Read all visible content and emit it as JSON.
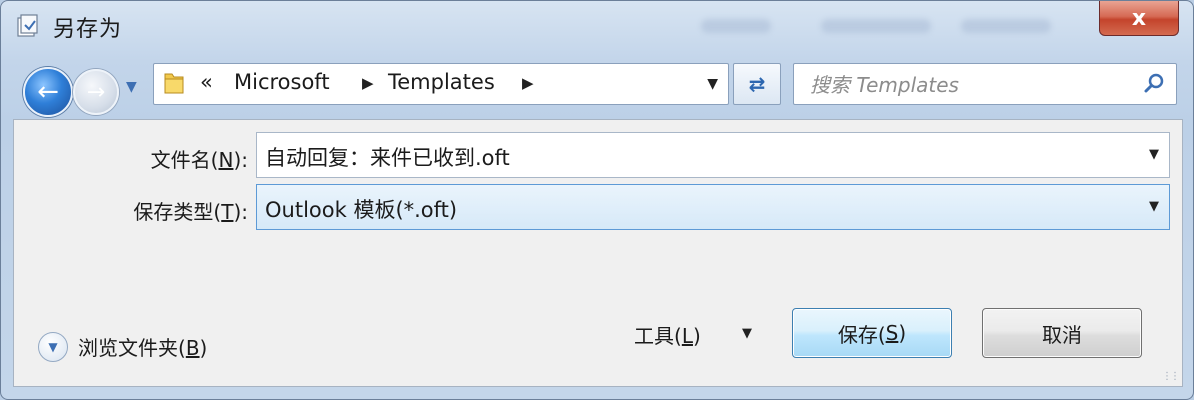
{
  "window": {
    "title": "另存为",
    "close_label": "x"
  },
  "nav": {
    "crumbs": [
      "«",
      "Microsoft",
      "Templates"
    ],
    "search_placeholder": "搜索 Templates"
  },
  "fields": {
    "filename_label_pre": "文件名(",
    "filename_label_key": "N",
    "filename_label_post": "):",
    "filename_value": "自动回复：来件已收到.oft",
    "type_label_pre": "保存类型(",
    "type_label_key": "T",
    "type_label_post": "):",
    "type_value": "Outlook 模板(*.oft)"
  },
  "footer": {
    "browse_pre": "浏览文件夹(",
    "browse_key": "B",
    "browse_post": ")",
    "tools_pre": "工具(",
    "tools_key": "L",
    "tools_post": ")",
    "save_pre": "保存(",
    "save_key": "S",
    "save_post": ")",
    "cancel_label": "取消"
  },
  "colors": {
    "accent": "#3c7fb1",
    "close": "#c4442c"
  }
}
